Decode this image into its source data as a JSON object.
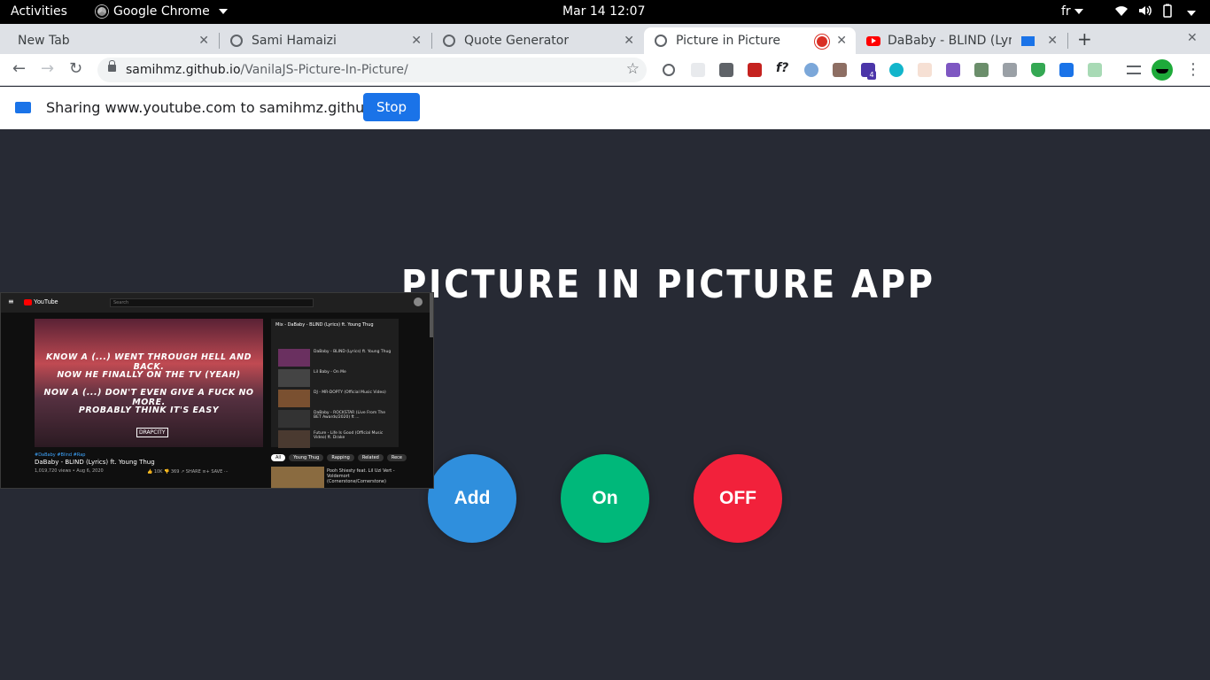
{
  "system": {
    "activities": "Activities",
    "app_name": "Google Chrome",
    "clock": "Mar 14  12:07",
    "lang": "fr"
  },
  "tabs": [
    {
      "title": "New Tab",
      "icon": "none"
    },
    {
      "title": "Sami Hamaizi",
      "icon": "globe-icon"
    },
    {
      "title": "Quote Generator",
      "icon": "globe-icon"
    },
    {
      "title": "Picture in Picture",
      "icon": "globe-icon",
      "active": true,
      "recording": true
    },
    {
      "title": "DaBaby - BLIND (Lyric",
      "icon": "youtube-icon",
      "pip": true
    }
  ],
  "omnibox": {
    "host": "samihmz.github.io",
    "path": "/VanilaJS-Picture-In-Picture/"
  },
  "share_bar": {
    "text": "Sharing www.youtube.com to samihmz.github.io",
    "stop_label": "Stop"
  },
  "page": {
    "title": "PICTURE IN PICTURE APP",
    "buttons": [
      {
        "label": "Add",
        "color": "#2f8fdd"
      },
      {
        "label": "On",
        "color": "#00b87a"
      },
      {
        "label": "OFF",
        "color": "#f2213b"
      }
    ]
  },
  "pip_window": {
    "search_placeholder": "Search",
    "lyrics": [
      "KNOW A (...) WENT THROUGH HELL AND BACK.",
      "NOW HE FINALLY ON THE TV (YEAH)",
      "NOW A (...) DON'T EVEN GIVE A FUCK NO MORE.",
      "PROBABLY THINK IT'S EASY"
    ],
    "stamp": "DRAPCITY",
    "hashtags": "#DaBaby #Blind #Rap",
    "video_title": "DaBaby - BLIND (Lyrics) ft. Young Thug",
    "views": "1,019,720 views • Aug 6, 2020",
    "actions": "👍 10K   👎 369   ↗ SHARE   ≡+ SAVE   ···",
    "sidebar_head": "Mix - DaBaby - BLIND (Lyrics) ft. Young Thug",
    "sidebar_items": [
      "DaBaby - BLIND (Lyrics) ft. Young Thug",
      "Lil Baby - On Me",
      "DJ - MR-DOPTY (Official Music Video)",
      "DaBaby - ROCKSTAR (Live From The BET Awards/2020) ft ...",
      "Future - Life Is Good (Official Music Video) ft. Drake"
    ],
    "chips": [
      "All",
      "Young Thug",
      "Rapping",
      "Related",
      "Rece"
    ],
    "rec_title": "Pooh Shiesty feat. Lil Uzi Vert - Voldemort (Cornerstone/Cornerstone)"
  }
}
